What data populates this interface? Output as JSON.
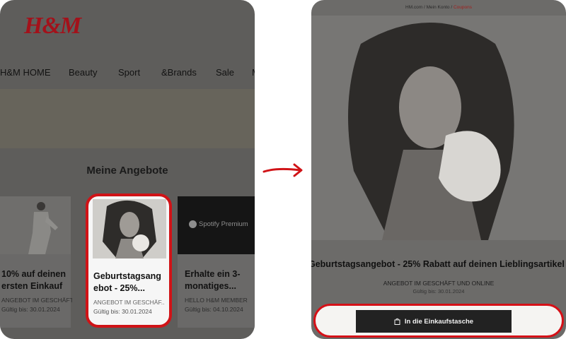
{
  "left": {
    "logo": "H&M",
    "nav": [
      "H&M HOME",
      "Beauty",
      "Sport",
      "&Brands",
      "Sale"
    ],
    "section_title": "Meine Angebote",
    "cards": [
      {
        "title": "10% auf deinen ersten Einkauf",
        "title_shown": "10% auf deinen\nersten Einkauf",
        "sub": "ANGEBOT IM GESCHÄFT",
        "date": "Gültig bis: 30.01.2024"
      },
      {
        "title": "Geburtstagsangebot - 25%...",
        "title_shown": "Geburtstagsang\nebot - 25%...",
        "sub": "ANGEBOT IM GESCHÄF...",
        "date": "Gültig bis: 30.01.2024"
      },
      {
        "title": "Erhalte ein 3-monatiges...",
        "title_shown": "Erhalte ein 3-\nmonatiges...",
        "sub": "HELLO H&M MEMBER",
        "date": "Gültig bis: 04.10.2024",
        "logo_text": "Spotify Premium"
      }
    ]
  },
  "right": {
    "breadcrumb": [
      "HM.com",
      "Mein Konto",
      "Coupons"
    ],
    "title": "Geburtstagsangebot - 25% Rabatt auf deinen Lieblingsartikel",
    "sub": "ANGEBOT IM GESCHÄFT UND ONLINE",
    "date": "Gültig bis: 30.01.2024",
    "cta": "In die Einkaufstasche"
  },
  "colors": {
    "accent": "#d01317",
    "brand": "#a3111a"
  }
}
